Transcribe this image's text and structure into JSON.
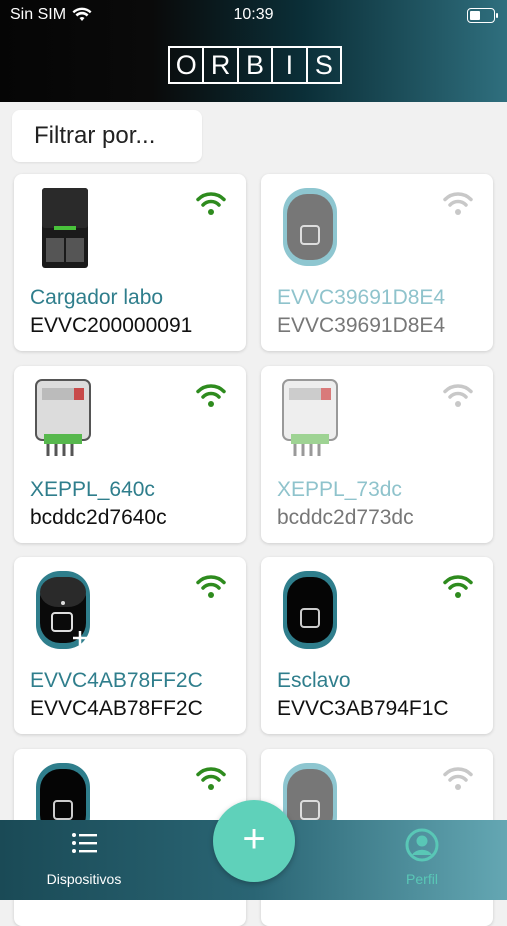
{
  "status": {
    "carrier": "Sin SIM",
    "time": "10:39"
  },
  "header": {
    "logo_letters": [
      "O",
      "R",
      "B",
      "I",
      "S"
    ]
  },
  "filter": {
    "placeholder": "Filtrar por..."
  },
  "devices": [
    {
      "name": "Cargador labo",
      "serial": "EVVC200000091",
      "online": true,
      "type": "charger-dark"
    },
    {
      "name": "EVVC39691D8E4",
      "serial": "EVVC39691D8E4",
      "online": false,
      "type": "charger-grey"
    },
    {
      "name": "XEPPL_640c",
      "serial": "bcddc2d7640c",
      "online": true,
      "type": "meter"
    },
    {
      "name": "XEPPL_73dc",
      "serial": "bcddc2d773dc",
      "online": false,
      "type": "meter"
    },
    {
      "name": "EVVC4AB78FF2C",
      "serial": "EVVC4AB78FF2C",
      "online": true,
      "type": "charger-black-plus"
    },
    {
      "name": "Esclavo",
      "serial": "EVVC3AB794F1C",
      "online": true,
      "type": "charger-black"
    },
    {
      "name": "",
      "serial": "",
      "online": true,
      "type": "charger-black"
    },
    {
      "name": "",
      "serial": "",
      "online": false,
      "type": "charger-grey"
    }
  ],
  "tabbar": {
    "devices_label": "Dispositivos",
    "profile_label": "Perfil",
    "fab_label": "+"
  },
  "colors": {
    "online": "#2e8b1e",
    "offline": "#c8c8c8",
    "accent": "#2f7e8c",
    "fab": "#5fd1ba"
  }
}
